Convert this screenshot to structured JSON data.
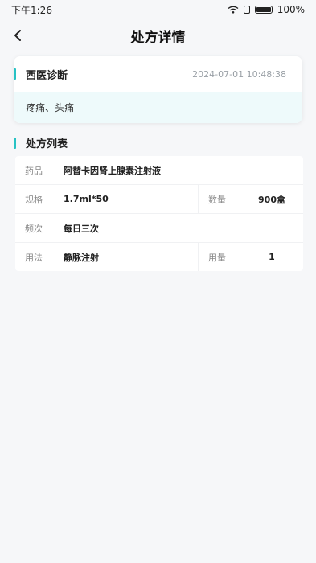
{
  "status_bar": {
    "time": "下午1:26",
    "battery": "100%",
    "icons": [
      "wifi-icon",
      "sim-icon",
      "battery-icon"
    ]
  },
  "nav": {
    "back_icon": "chevron-left-icon",
    "title": "处方详情"
  },
  "diagnosis": {
    "title": "西医诊断",
    "date": "2024-07-01 10:48:38",
    "content": "疼痛、头痛"
  },
  "prescription": {
    "title": "处方列表",
    "drug_label": "药品",
    "drug_value": "阿替卡因肾上腺素注射液",
    "spec_label": "规格",
    "spec_value": "1.7ml*50",
    "qty_label": "数量",
    "qty_value": "900盒",
    "freq_label": "频次",
    "freq_value": "每日三次",
    "usage_label": "用法",
    "usage_value": "静脉注射",
    "dose_label": "用量",
    "dose_value": "1"
  },
  "colors": {
    "accent": "#27c2c4",
    "diagnosis_bg": "#eefafb",
    "page_bg": "#f6f7f9"
  }
}
